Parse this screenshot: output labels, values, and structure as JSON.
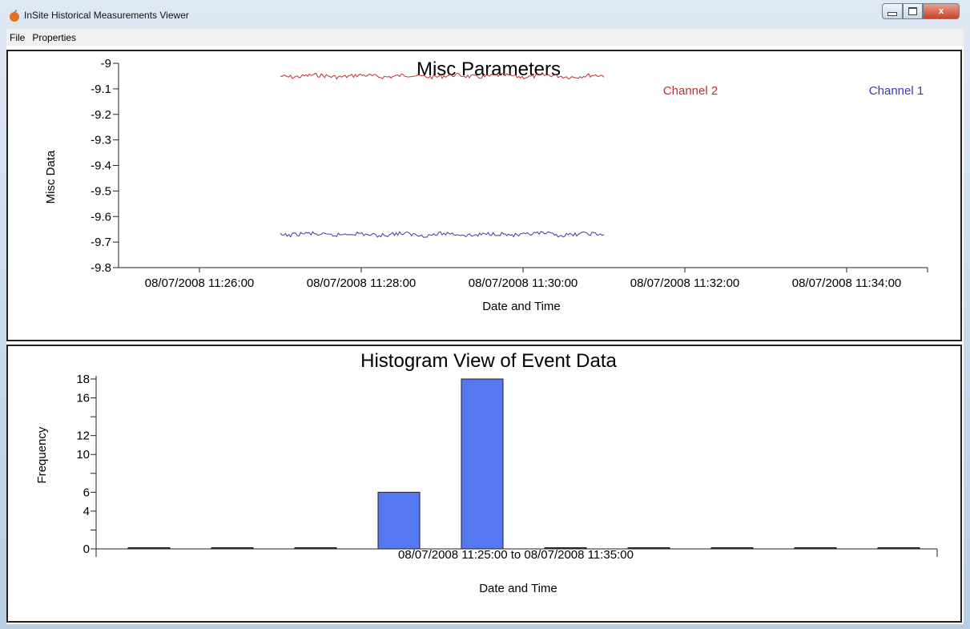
{
  "window": {
    "title": "InSite Historical Measurements Viewer",
    "minimize_icon": "minimize-icon",
    "maximize_icon": "maximize-icon",
    "close_icon": "close-icon",
    "close_label": "x"
  },
  "menu": {
    "file": "File",
    "properties": "Properties"
  },
  "charts": {
    "misc": {
      "title": "Misc Parameters",
      "ylabel": "Misc Data",
      "xlabel": "Date and Time",
      "y_ticks": [
        "-9",
        "-9.1",
        "-9.2",
        "-9.3",
        "-9.4",
        "-9.5",
        "-9.6",
        "-9.7",
        "-9.8"
      ],
      "x_ticks": [
        "08/07/2008 11:26:00",
        "08/07/2008 11:28:00",
        "08/07/2008 11:30:00",
        "08/07/2008 11:32:00",
        "08/07/2008 11:34:00"
      ],
      "channel2_label": "Channel 2",
      "channel1_label": "Channel 1"
    },
    "histogram": {
      "title": "Histogram View of Event Data",
      "ylabel": "Frequency",
      "xlabel": "Date and Time",
      "x_range_label": "08/07/2008 11:25:00 to 08/07/2008 11:35:00",
      "y_ticks": [
        "18",
        "16",
        "12",
        "10",
        "6",
        "4",
        "0"
      ]
    }
  },
  "colors": {
    "channel1": "#3b3bb0",
    "channel2": "#c03030",
    "bars": "#5577f0"
  },
  "chart_data": [
    {
      "type": "line",
      "title": "Misc Parameters",
      "xlabel": "Date and Time",
      "ylabel": "Misc Data",
      "ylim": [
        -9.8,
        -9.0
      ],
      "xlim": [
        "08/07/2008 11:25:00",
        "08/07/2008 11:35:00"
      ],
      "legend": "top-right",
      "series": [
        {
          "name": "Channel 2",
          "color": "#c03030",
          "x": [
            "08/07/2008 11:27:00",
            "08/07/2008 11:31:00"
          ],
          "values": [
            -9.05,
            -9.05
          ]
        },
        {
          "name": "Channel 1",
          "color": "#3b3bb0",
          "x": [
            "08/07/2008 11:27:00",
            "08/07/2008 11:31:00"
          ],
          "values": [
            -9.67,
            -9.67
          ]
        }
      ]
    },
    {
      "type": "bar",
      "title": "Histogram View of Event Data",
      "xlabel": "Date and Time",
      "ylabel": "Frequency",
      "ylim": [
        0,
        18
      ],
      "x_range": "08/07/2008 11:25:00 to 08/07/2008 11:35:00",
      "bins": 10,
      "values": [
        0,
        0,
        0,
        6,
        18,
        0,
        0,
        0,
        0,
        0
      ]
    }
  ]
}
